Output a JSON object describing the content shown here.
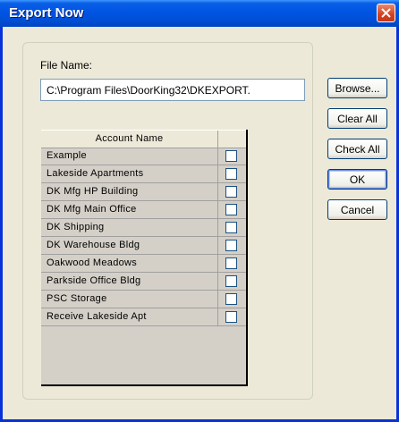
{
  "window": {
    "title": "Export Now"
  },
  "file": {
    "label": "File Name:",
    "value": "C:\\Program Files\\DoorKing32\\DKEXPORT."
  },
  "grid": {
    "header": "Account Name",
    "rows": [
      {
        "name": "Example",
        "checked": false
      },
      {
        "name": "Lakeside Apartments",
        "checked": false
      },
      {
        "name": "DK Mfg HP Building",
        "checked": false
      },
      {
        "name": "DK Mfg Main Office",
        "checked": false
      },
      {
        "name": "DK Shipping",
        "checked": false
      },
      {
        "name": "DK Warehouse Bldg",
        "checked": false
      },
      {
        "name": "Oakwood Meadows",
        "checked": false
      },
      {
        "name": "Parkside Office Bldg",
        "checked": false
      },
      {
        "name": "PSC Storage",
        "checked": false
      },
      {
        "name": "Receive Lakeside Apt",
        "checked": false
      }
    ]
  },
  "buttons": {
    "browse": "Browse...",
    "clear_all": "Clear All",
    "check_all": "Check All",
    "ok": "OK",
    "cancel": "Cancel"
  },
  "icons": {
    "close": "close-icon"
  },
  "colors": {
    "titlebar": "#0054e3",
    "window_bg": "#ece9d8",
    "close_button": "#d44020"
  }
}
